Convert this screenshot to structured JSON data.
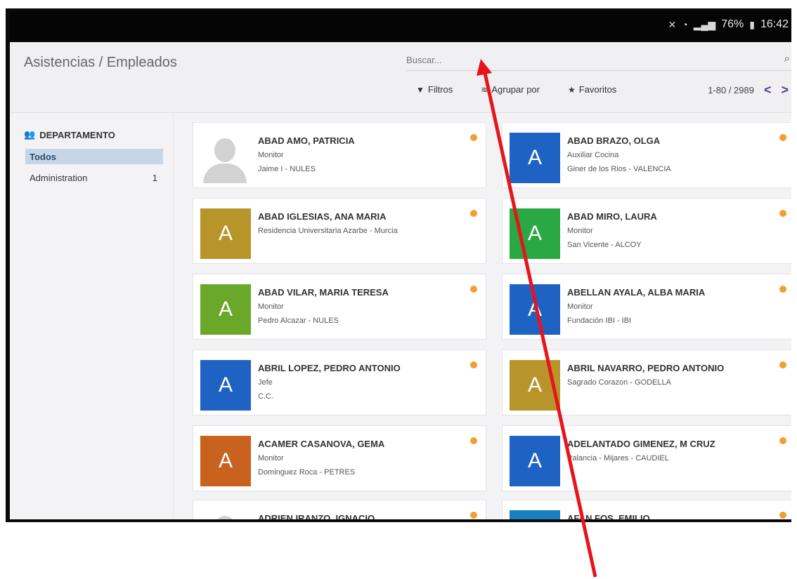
{
  "status": {
    "battery": "76%",
    "time": "16:42"
  },
  "header": {
    "breadcrumb": "Asistencias / Empleados"
  },
  "search": {
    "placeholder": "Buscar..."
  },
  "toolbar": {
    "filters": "Filtros",
    "group_by": "Agrupar por",
    "favorites": "Favoritos"
  },
  "pager": {
    "range": "1-80 / 2989"
  },
  "sidebar": {
    "title": "DEPARTAMENTO",
    "items": [
      {
        "label": "Todos",
        "count": ""
      },
      {
        "label": "Administration",
        "count": "1"
      }
    ]
  },
  "colors": {
    "accent": "#7a5c9e",
    "status_dot": "#f0a030",
    "active_item": "#c7d6e6"
  },
  "employees": [
    {
      "name": "ABAD AMO, PATRICIA",
      "line1": "Monitor",
      "line2": "Jaime I - NULES",
      "avatar": "",
      "color": ""
    },
    {
      "name": "ABAD BRAZO, OLGA",
      "line1": "Auxiliar Cocina",
      "line2": "Giner de los Rios - VALENCIA",
      "avatar": "A",
      "color": "#1e63c4"
    },
    {
      "name": "ABAD IGLESIAS, ANA MARIA",
      "line1": "Residencia Universitaria Azarbe - Murcia",
      "line2": "",
      "avatar": "A",
      "color": "#b8952a"
    },
    {
      "name": "ABAD MIRO, LAURA",
      "line1": "Monitor",
      "line2": "San Vicente - ALCOY",
      "avatar": "A",
      "color": "#2aa844"
    },
    {
      "name": "ABAD VILAR, MARIA TERESA",
      "line1": "Monitor",
      "line2": "Pedro Alcazar - NULES",
      "avatar": "A",
      "color": "#6aa82a"
    },
    {
      "name": "ABELLAN AYALA, ALBA MARIA",
      "line1": "Monitor",
      "line2": "Fundación IBI - IBI",
      "avatar": "A",
      "color": "#1e63c4"
    },
    {
      "name": "ABRIL LOPEZ, PEDRO ANTONIO",
      "line1": "Jefe",
      "line2": "C.C.",
      "avatar": "A",
      "color": "#1e63c4"
    },
    {
      "name": "ABRIL NAVARRO, PEDRO ANTONIO",
      "line1": "Sagrado Corazon - GODELLA",
      "line2": "",
      "avatar": "A",
      "color": "#b8952a"
    },
    {
      "name": "ACAMER CASANOVA, GEMA",
      "line1": "Monitor",
      "line2": "Dominguez Roca - PETRES",
      "avatar": "A",
      "color": "#c8621e"
    },
    {
      "name": "ADELANTADO GIMENEZ, M CRUZ",
      "line1": "Palancia - Mijares - CAUDIEL",
      "line2": "",
      "avatar": "A",
      "color": "#1e63c4"
    },
    {
      "name": "ADRIEN IRANZO, IGNACIO",
      "line1": "",
      "line2": "",
      "avatar": "",
      "color": ""
    },
    {
      "name": "AFAN FOS, EMILIO",
      "line1": "",
      "line2": "",
      "avatar": "A",
      "color": "#1a7fbf"
    }
  ]
}
